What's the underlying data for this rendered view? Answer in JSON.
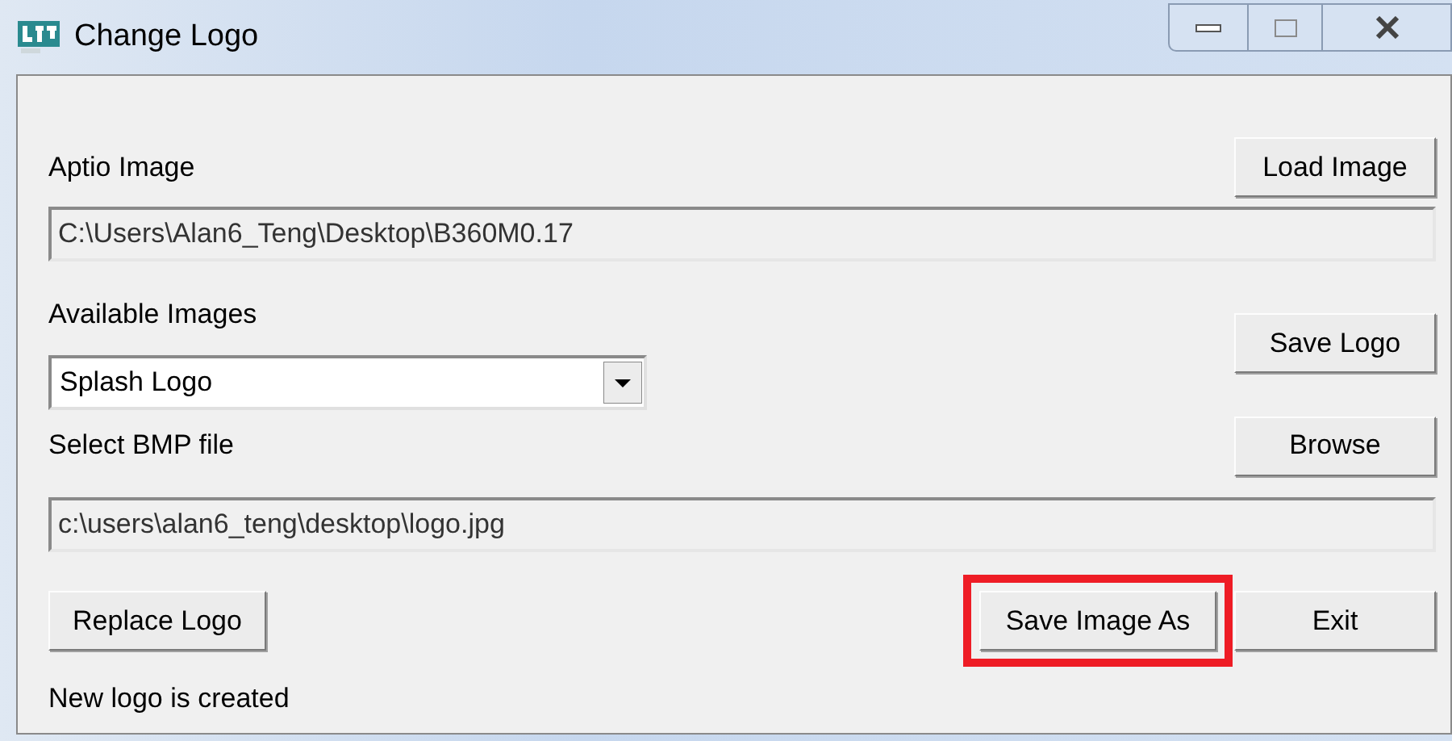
{
  "window": {
    "title": "Change Logo"
  },
  "aptio_image": {
    "label": "Aptio Image",
    "value": "C:\\Users\\Alan6_Teng\\Desktop\\B360M0.17",
    "button": "Load Image"
  },
  "available_images": {
    "label": "Available Images",
    "value": "Splash Logo",
    "button": "Save Logo"
  },
  "bmp_file": {
    "label": "Select BMP file",
    "value": "c:\\users\\alan6_teng\\desktop\\logo.jpg",
    "button": "Browse"
  },
  "buttons": [
    {
      "label": "Replace Logo",
      "highlighted": false
    },
    {
      "label": "Save Image As",
      "highlighted": true
    },
    {
      "label": "Exit",
      "highlighted": false
    }
  ],
  "status": "New logo is created"
}
